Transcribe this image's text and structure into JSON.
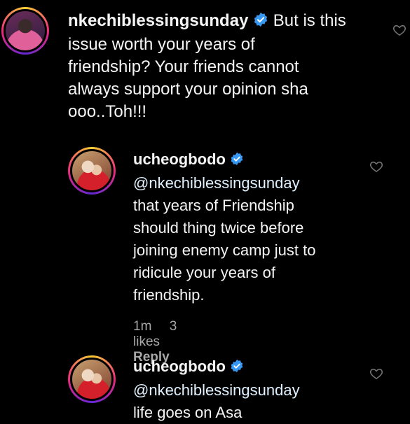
{
  "comments": [
    {
      "username": "nkechiblessingsunday",
      "text_inline": "But is this",
      "text_lines": [
        "issue worth your years of",
        "friendship? Your friends cannot",
        "always support your opinion sha",
        "ooo..Toh!!!"
      ]
    }
  ],
  "replies": [
    {
      "username": "ucheogbodo",
      "mention": "@nkechiblessingsunday",
      "text_lines": [
        "that years of Friendship",
        "should thing twice before",
        "joining enemy camp just to",
        "ridicule your years of",
        "friendship."
      ],
      "time": "1m",
      "likes": "3 likes",
      "reply_label": "Reply"
    },
    {
      "username": "ucheogbodo",
      "mention": "@nkechiblessingsunday",
      "text_lines": [
        "life goes on Asa"
      ]
    }
  ],
  "icons": {
    "verified": "verified-badge-icon",
    "like": "heart-outline-icon"
  },
  "colors": {
    "background": "#000000",
    "verified_blue": "#3897f0",
    "meta_gray": "#a8a8a8"
  }
}
